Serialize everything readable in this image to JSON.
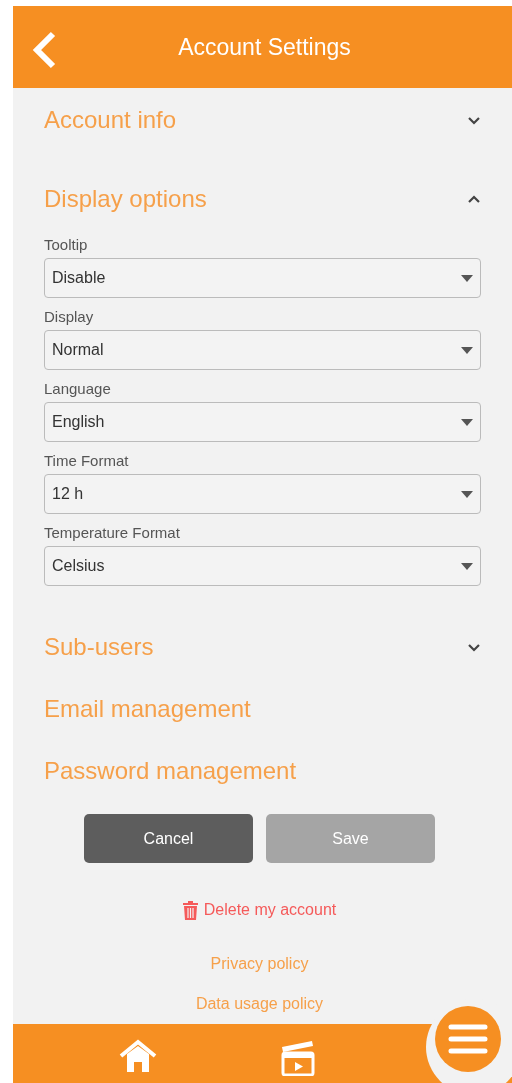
{
  "header": {
    "title": "Account Settings"
  },
  "sections": [
    {
      "kind": "accordion",
      "title": "Account info",
      "expanded": false
    },
    {
      "kind": "accordion",
      "title": "Display options",
      "expanded": true,
      "fields": [
        {
          "label": "Tooltip",
          "value": "Disable"
        },
        {
          "label": "Display",
          "value": "Normal"
        },
        {
          "label": "Language",
          "value": "English"
        },
        {
          "label": "Time Format",
          "value": "12 h"
        },
        {
          "label": "Temperature Format",
          "value": "Celsius"
        }
      ]
    },
    {
      "kind": "accordion",
      "title": "Sub-users",
      "expanded": false
    },
    {
      "kind": "link",
      "title": "Email management"
    },
    {
      "kind": "link",
      "title": "Password management"
    }
  ],
  "buttons": [
    {
      "label": "Cancel",
      "disabled": false
    },
    {
      "label": "Save",
      "disabled": true
    }
  ],
  "delete_link": "Delete my account",
  "footer_links": [
    "Privacy policy",
    "Data usage policy"
  ]
}
